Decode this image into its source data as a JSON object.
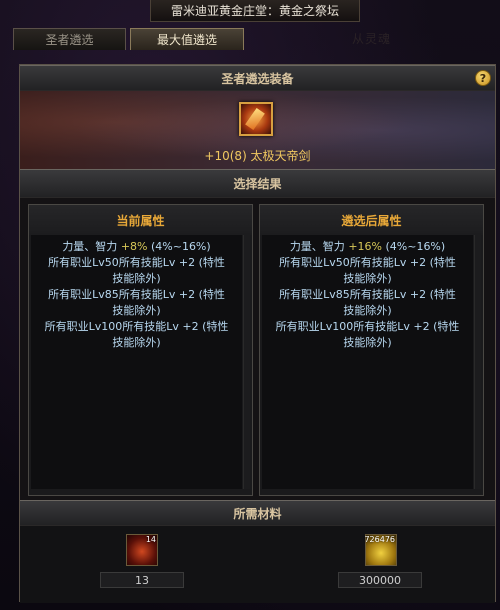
{
  "window": {
    "title": "雷米迪亚黄金庄堂：黄金之祭坛"
  },
  "tabs": [
    {
      "label": "圣者遴选",
      "active": false
    },
    {
      "label": "最大值遴选",
      "active": true
    },
    {
      "label": "从灵魂",
      "active": false
    }
  ],
  "equipment": {
    "header": "圣者遴选装备",
    "help_icon": "?",
    "item_name": "+10(8) 太极天帝剑",
    "item_icon": "sword-icon"
  },
  "result": {
    "header": "选择结果",
    "current": {
      "title": "当前属性",
      "stat_name": "力量、智力 ",
      "stat_value": "+8%",
      "stat_range": " (4%~16%)",
      "lines": [
        "所有职业Lv50所有技能Lv +2 (特性",
        "技能除外)",
        "所有职业Lv85所有技能Lv +2 (特性",
        "技能除外)",
        "所有职业Lv100所有技能Lv +2 (特性",
        "技能除外)"
      ]
    },
    "after": {
      "title": "遴选后属性",
      "stat_name": "力量、智力 ",
      "stat_value": "+16%",
      "stat_range": " (4%~16%)",
      "lines": [
        "所有职业Lv50所有技能Lv +2 (特性",
        "技能除外)",
        "所有职业Lv85所有技能Lv +2 (特性",
        "技能除外)",
        "所有职业Lv100所有技能Lv +2 (特性",
        "技能除外)"
      ]
    }
  },
  "materials": {
    "header": "所需材料",
    "items": [
      {
        "icon": "material-icon",
        "stack": "14",
        "amount": "13"
      },
      {
        "icon": "gold-icon",
        "stack": "726476",
        "amount": "300000"
      }
    ]
  },
  "colors": {
    "accent_gold": "#e8a838",
    "stat_text": "#b8d8f0",
    "value_highlight": "#d8c858"
  }
}
